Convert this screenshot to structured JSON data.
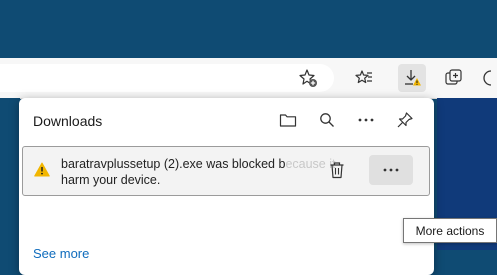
{
  "colors": {
    "titlebar": "#0f4b73",
    "toolbar": "#f7f7f7",
    "panel": "#ffffff",
    "warning": "#f2b600",
    "link": "#0f6cbd"
  },
  "toolbar": {
    "buttons": [
      {
        "name": "favorites-add",
        "icon": "star-plus-icon"
      },
      {
        "name": "favorites",
        "icon": "favorites-list-icon"
      },
      {
        "name": "downloads",
        "icon": "download-warning-icon",
        "active": true
      },
      {
        "name": "collections",
        "icon": "collections-icon"
      },
      {
        "name": "profile",
        "icon": "profile-icon"
      }
    ]
  },
  "downloads_panel": {
    "title": "Downloads",
    "header_icons": [
      "folder-icon",
      "search-icon",
      "more-options-icon",
      "pin-icon"
    ],
    "item": {
      "icon": "warning-icon",
      "filename_text": "baratravplussetup (2).exe was blocked b",
      "faded_text": "ecause it could",
      "line2": "harm your device.",
      "delete_icon": "trash-icon",
      "more_label": "···"
    },
    "see_more": "See more"
  },
  "tooltip": {
    "text": "More actions"
  }
}
